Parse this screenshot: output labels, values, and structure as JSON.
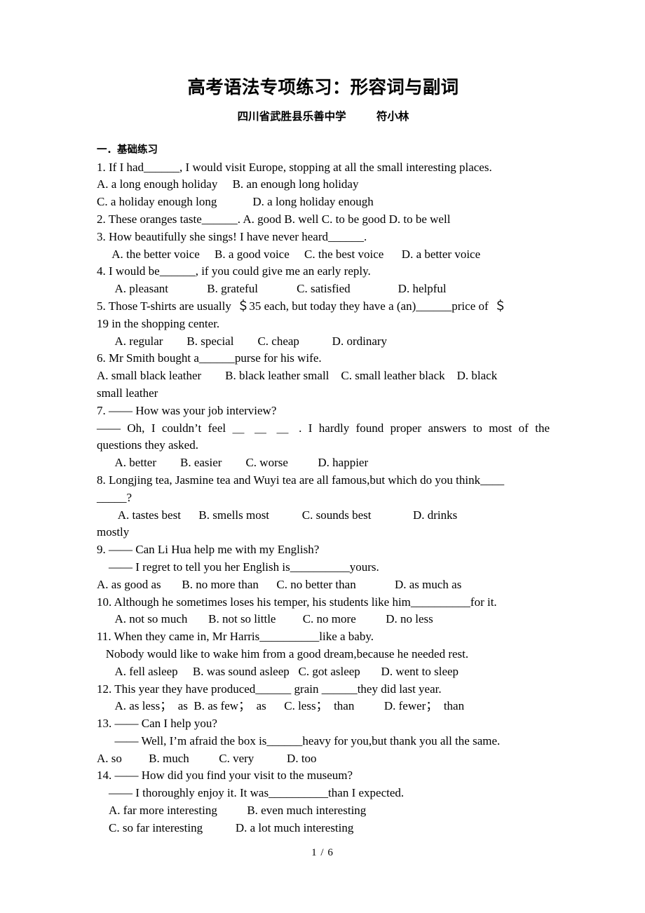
{
  "document": {
    "title": "高考语法专项练习：形容词与副词",
    "subtitle": "四川省武胜县乐善中学        符小林",
    "section_heading": "一．基础练习",
    "footer": "1 / 6"
  },
  "lines": {
    "l01": "1. If I had______, I would visit Europe, stopping at all the small interesting places.",
    "l02": "A. a long enough holiday     B. an enough long holiday",
    "l03": "C. a holiday enough long            D. a long holiday enough",
    "l04": "2. These oranges taste______. A. good B. well C. to be good D. to be well",
    "l05": "3. How beautifully she sings! I have never heard______.",
    "l06": "     A. the better voice     B. a good voice     C. the best voice      D. a better voice",
    "l07": "4. I would be______, if you could give me an early reply.",
    "l08": "      A. pleasant             B. grateful             C. satisfied                D. helpful",
    "l09": "5. Those T-shirts are usually  ＄35 each, but today they have a (an)______price of  ＄",
    "l10": "19 in the shopping center.",
    "l11": "      A. regular        B. special        C. cheap           D. ordinary",
    "l12": "6. Mr Smith bought a______purse for his wife.",
    "l13": "A. small black leather        B. black leather small    C. small leather black    D. black",
    "l14": "small leather",
    "l15": "7. —— How was your job interview?",
    "l16": "—— Oh, I couldn’t feel ＿ ＿ ＿ . I hardly found proper answers to most of the",
    "l17": "questions they asked.",
    "l18": "      A. better        B. easier        C. worse          D. happier",
    "l19": "8. Longjing tea, Jasmine tea and Wuyi tea are all famous,but which do you think____",
    "l20": "_____?",
    "l21": "       A. tastes best      B. smells most           C. sounds best              D. drinks",
    "l22": "mostly",
    "l23": "9. —— Can Li Hua help me with my English?",
    "l24": "    —— I regret to tell you her English is__________yours.",
    "l25": "A. as good as       B. no more than      C. no better than             D. as much as",
    "l26": "10. Although he sometimes loses his temper, his students like him__________for it.",
    "l27": "      A. not so much       B. not so little         C. no more          D. no less",
    "l28": "11. When they came in, Mr Harris__________like a baby.",
    "l29": "   Nobody would like to wake him from a good dream,because he needed rest.",
    "l30": "      A. fell asleep     B. was sound asleep   C. got asleep       D. went to sleep",
    "l31": "12. This year they have produced______ grain ______they did last year.",
    "l32": "      A. as less；  as  B. as few；  as      C. less；  than          D. fewer；  than",
    "l33": "13. —— Can I help you?",
    "l34": "      —— Well, I’m afraid the box is______heavy for you,but thank you all the same.",
    "l35": "A. so         B. much          C. very           D. too",
    "l36": "14. —— How did you find your visit to the museum?",
    "l37": "    —— I thoroughly enjoy it. It was__________than I expected.",
    "l38": "    A. far more interesting          B. even much interesting",
    "l39": "    C. so far interesting           D. a lot much interesting"
  }
}
